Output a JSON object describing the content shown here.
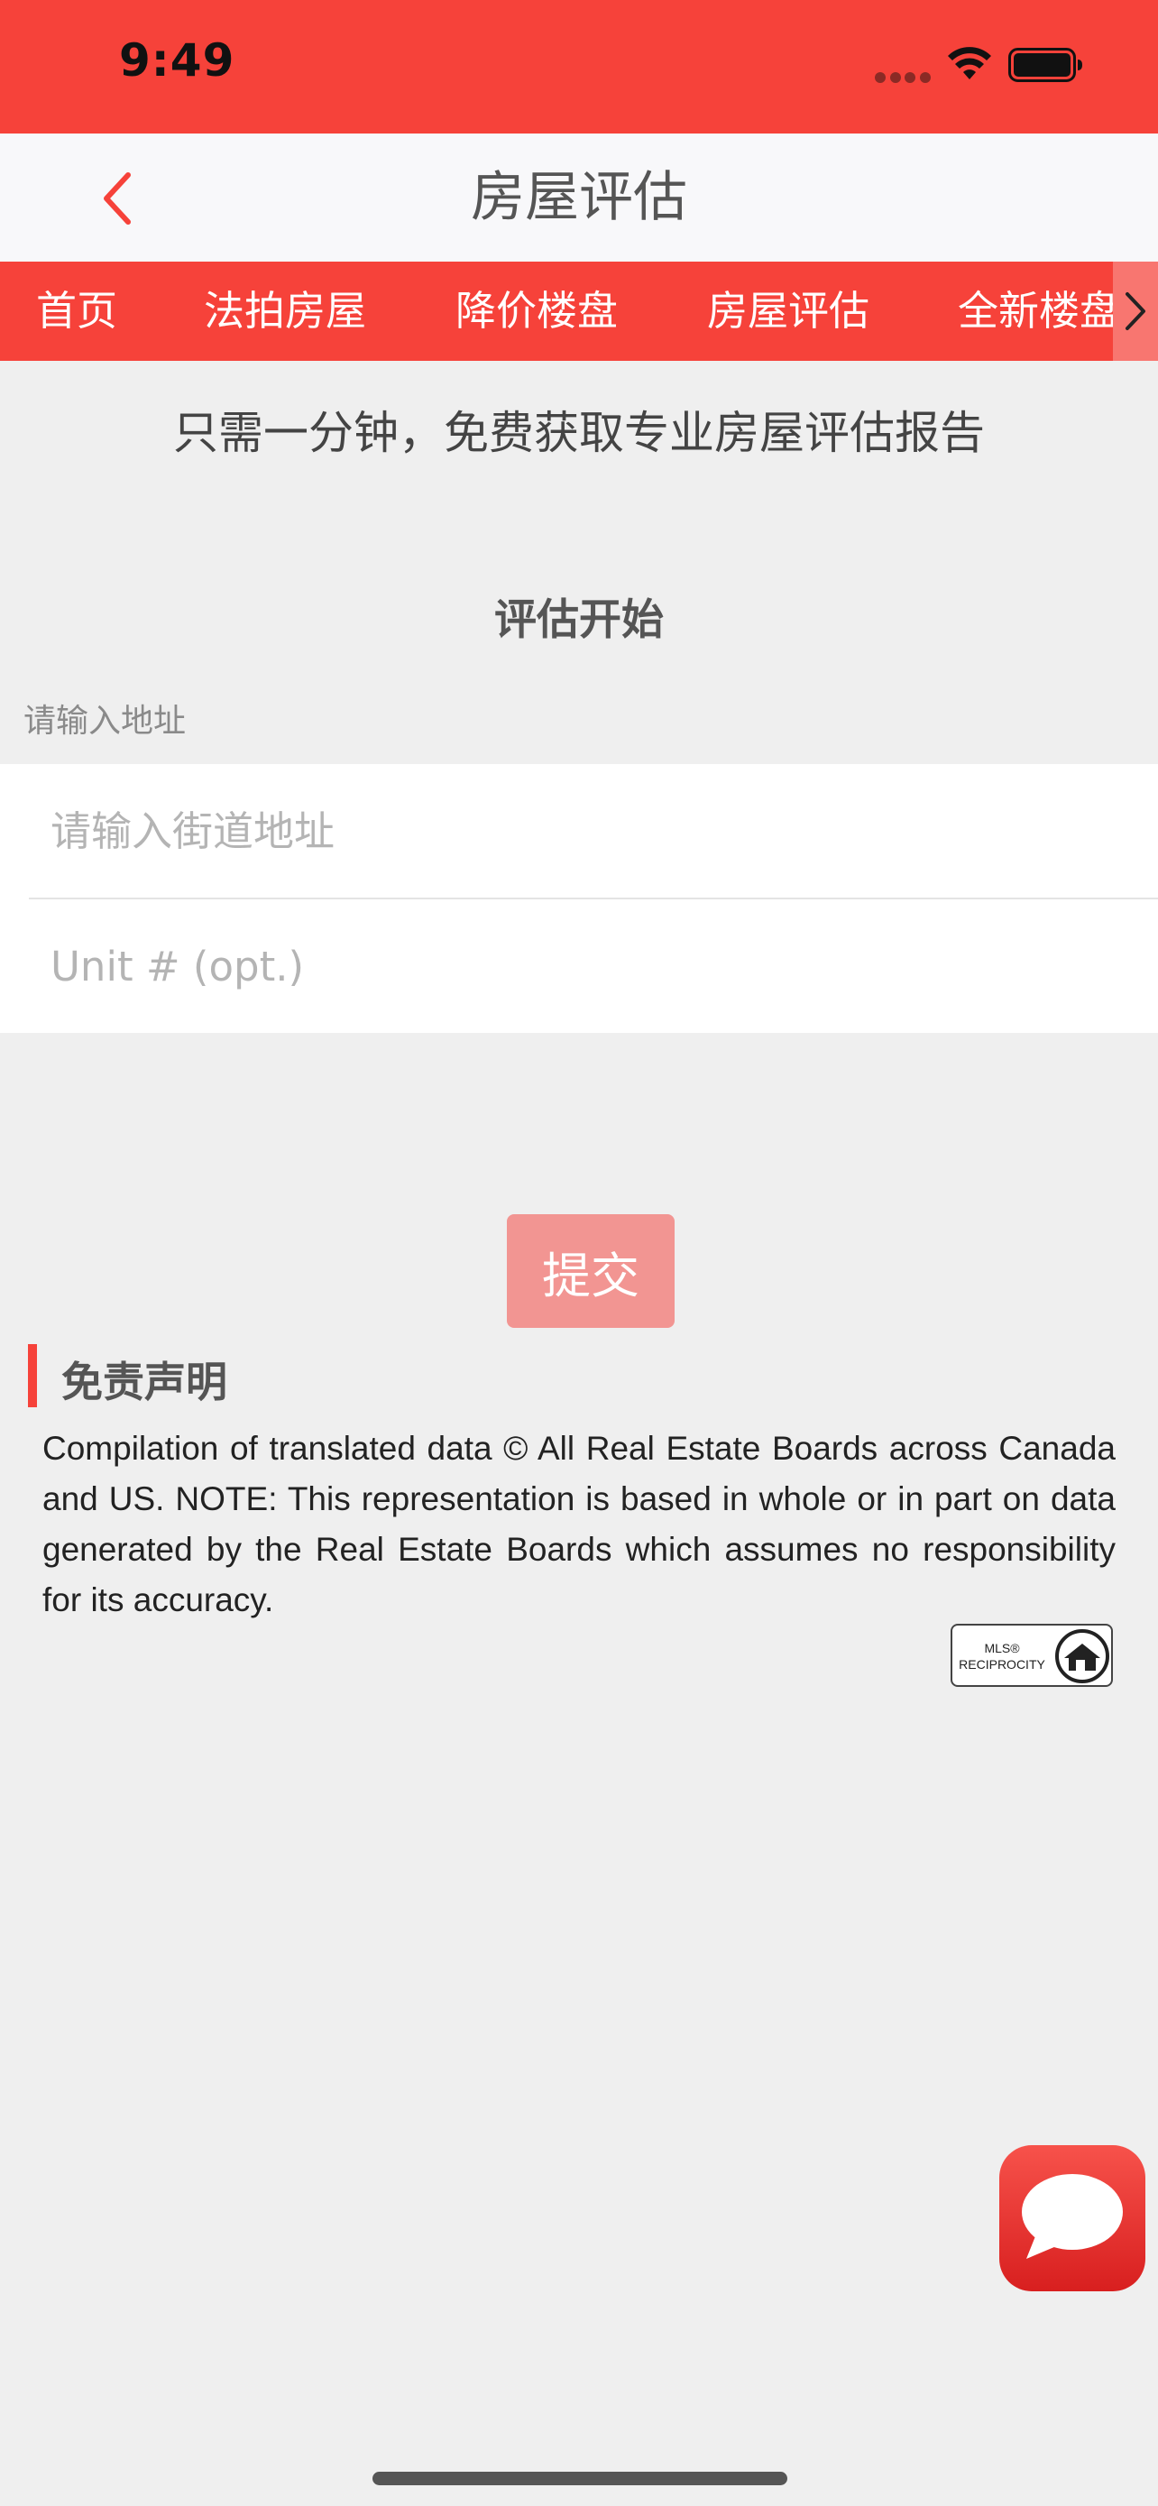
{
  "status_bar": {
    "time": "9:49"
  },
  "nav": {
    "title": "房屋评估"
  },
  "tabs": [
    {
      "label": "首页"
    },
    {
      "label": "法拍房屋"
    },
    {
      "label": "降价楼盘"
    },
    {
      "label": "房屋评估"
    },
    {
      "label": "全新楼盘"
    }
  ],
  "subtitle": "只需一分钟，免费获取专业房屋评估报告",
  "section_title": "评估开始",
  "form": {
    "address_label": "请输入地址",
    "street_placeholder": "请输入街道地址",
    "street_value": "",
    "unit_placeholder": "Unit # (opt.)",
    "unit_value": ""
  },
  "submit_label": "提交",
  "disclaimer": {
    "title": "免责声明",
    "text": "Compilation of translated data © All Real Estate Boards across Canada and US. NOTE: This representation is based in whole or in part on data generated by the Real Estate Boards which assumes no responsibility for its accuracy."
  },
  "mls_logo": {
    "text_line1": "MLS®",
    "text_line2": "RECIPROCITY"
  },
  "colors": {
    "brand_red": "#f6423a",
    "submit_disabled": "#f29592",
    "page_background": "#efefef"
  },
  "icons": {
    "back": "chevron-left-icon",
    "tabs_more": "chevron-right-icon",
    "chat": "chat-bubble-icon",
    "wifi": "wifi-icon",
    "battery": "battery-icon"
  }
}
